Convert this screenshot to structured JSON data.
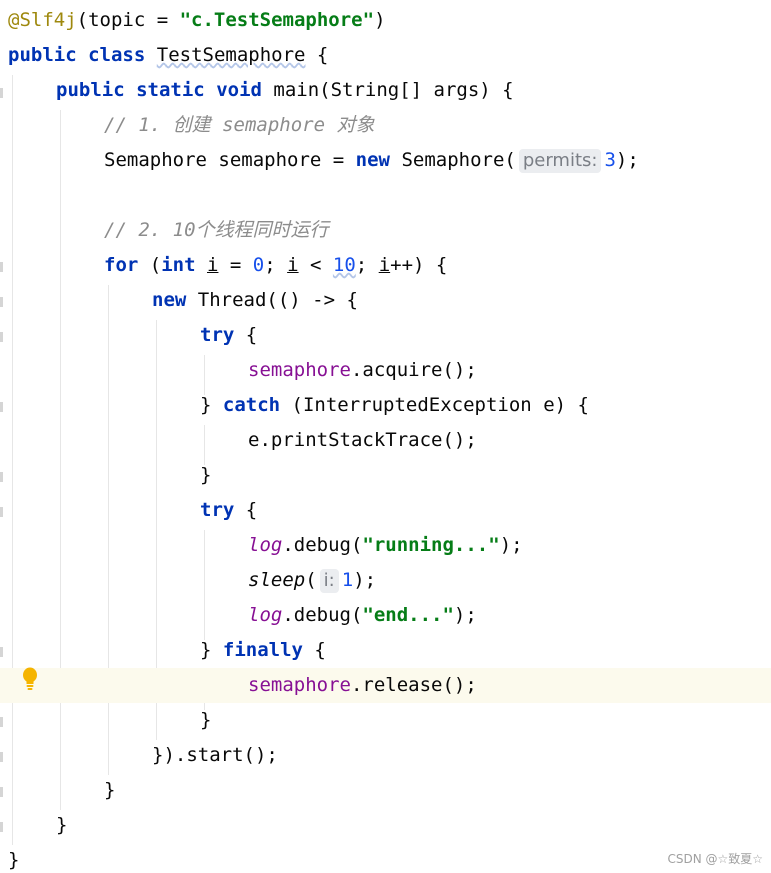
{
  "code": {
    "annotation": "@Slf4j",
    "annotation_args_open": "(topic = ",
    "annotation_topic": "\"c.TestSemaphore\"",
    "annotation_args_close": ")",
    "class_kw1": "public",
    "class_kw2": "class",
    "class_name": "TestSemaphore",
    "class_brace": " {",
    "main_kw1": "public",
    "main_kw2": "static",
    "main_kw3": "void",
    "main_sig": "main(String[] args) {",
    "comment1": "// 1. 创建 semaphore 对象",
    "decl_type": "Semaphore semaphore = ",
    "decl_new": "new",
    "decl_ctor": " Semaphore(",
    "hint_permits": "permits:",
    "permits_value": "3",
    "decl_end": ");",
    "comment2": "// 2. 10个线程同时运行",
    "for_kw": "for",
    "for_open": " (",
    "for_int": "int",
    "for_var1": "i",
    "for_eq": " = ",
    "for_zero": "0",
    "for_semi1": "; ",
    "for_var2": "i",
    "for_lt": " < ",
    "for_ten": "10",
    "for_semi2": "; ",
    "for_var3": "i",
    "for_close": "++) {",
    "thread_new": "new",
    "thread_rest": " Thread(() -> {",
    "try1": "try",
    "brace_open": " {",
    "acquire_field": "semaphore",
    "acquire_call": ".acquire();",
    "catch_close": "} ",
    "catch_kw": "catch",
    "catch_rest": " (InterruptedException e) {",
    "print_trace": "e.printStackTrace();",
    "close_brace1": "}",
    "try2": "try",
    "log1_field": "log",
    "log1_call": ".debug(",
    "log1_str": "\"running...\"",
    "log1_end": ");",
    "sleep_call": "sleep",
    "sleep_open": "(",
    "hint_i": "i:",
    "sleep_value": "1",
    "sleep_end": ");",
    "log2_field": "log",
    "log2_call": ".debug(",
    "log2_str": "\"end...\"",
    "log2_end": ");",
    "finally_close": "} ",
    "finally_kw": "finally",
    "release_field": "semaphore",
    "release_call": ".release();",
    "close_brace2": "}",
    "thread_end": "}).start();",
    "close_brace3": "}",
    "close_brace4": "}",
    "close_brace5": "}"
  },
  "watermark": "CSDN @☆致夏☆",
  "colors": {
    "keyword": "#0033b3",
    "annotation": "#9e880d",
    "string": "#067d17",
    "number": "#1750eb",
    "comment": "#8c8c8c",
    "field": "#871094",
    "highlight_line": "#fcfaed",
    "bulb": "#f5b400"
  }
}
